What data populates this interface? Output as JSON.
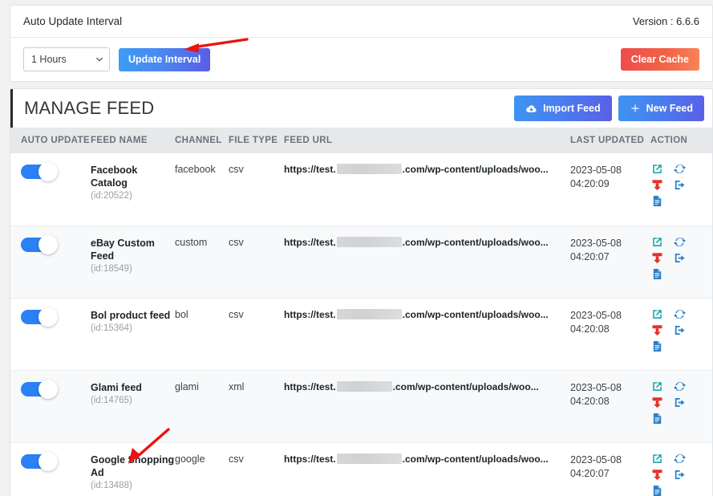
{
  "top_panel": {
    "title": "Auto Update Interval",
    "version_label": "Version : 6.6.6",
    "interval_value": "1 Hours",
    "interval_options": [
      "1 Hours"
    ],
    "update_button": "Update Interval",
    "clear_cache_button": "Clear Cache"
  },
  "feed_panel": {
    "title": "MANAGE FEED",
    "import_button": "Import Feed",
    "new_button": "New Feed",
    "columns": {
      "auto_update": "AUTO UPDATE",
      "feed_name": "FEED NAME",
      "channel": "CHANNEL",
      "file_type": "FILE TYPE",
      "feed_url": "FEED URL",
      "last_updated": "LAST UPDATED",
      "action": "ACTION"
    },
    "rows": [
      {
        "auto_update": true,
        "name": "Facebook Catalog",
        "id": "(id:20522)",
        "channel": "facebook",
        "file_type": "csv",
        "url_prefix": "https://test.",
        "url_suffix": ".com/wp-content/uploads/woo...",
        "last_updated_date": "2023-05-08",
        "last_updated_time": "04:20:09"
      },
      {
        "auto_update": true,
        "name": "eBay Custom Feed",
        "id": "(id:18549)",
        "channel": "custom",
        "file_type": "csv",
        "url_prefix": "https://test.",
        "url_suffix": ".com/wp-content/uploads/woo...",
        "last_updated_date": "2023-05-08",
        "last_updated_time": "04:20:07"
      },
      {
        "auto_update": true,
        "name": "Bol product feed",
        "id": "(id:15364)",
        "channel": "bol",
        "file_type": "csv",
        "url_prefix": "https://test.",
        "url_suffix": ".com/wp-content/uploads/woo...",
        "last_updated_date": "2023-05-08",
        "last_updated_time": "04:20:08"
      },
      {
        "auto_update": true,
        "name": "Glami feed",
        "id": "(id:14765)",
        "channel": "glami",
        "file_type": "xml",
        "url_prefix": "https://test.",
        "url_suffix": ".com/wp-content/uploads/woo...",
        "last_updated_date": "2023-05-08",
        "last_updated_time": "04:20:08"
      },
      {
        "auto_update": true,
        "name": "Google Shopping Ad",
        "id": "(id:13488)",
        "channel": "google",
        "file_type": "csv",
        "url_prefix": "https://test.",
        "url_suffix": ".com/wp-content/uploads/woo...",
        "last_updated_date": "2023-05-08",
        "last_updated_time": "04:20:07"
      }
    ],
    "row_action_icons": [
      "external-link-icon",
      "refresh-icon",
      "download-icon",
      "export-icon",
      "document-icon"
    ]
  },
  "annotations": [
    {
      "name": "arrow-to-update-interval-button",
      "color": "#ee1111"
    },
    {
      "name": "arrow-to-google-shopping-ad-row",
      "color": "#ee1111"
    }
  ],
  "colors": {
    "accent_blue": "#2a80f5",
    "gradient_blue_start": "#3e95f2",
    "gradient_purple_end": "#5b5fe6",
    "danger_red": "#ef4b4b",
    "danger_orange": "#f9845a",
    "header_grey": "#e7e8ea",
    "text_dark": "#1d2327"
  }
}
